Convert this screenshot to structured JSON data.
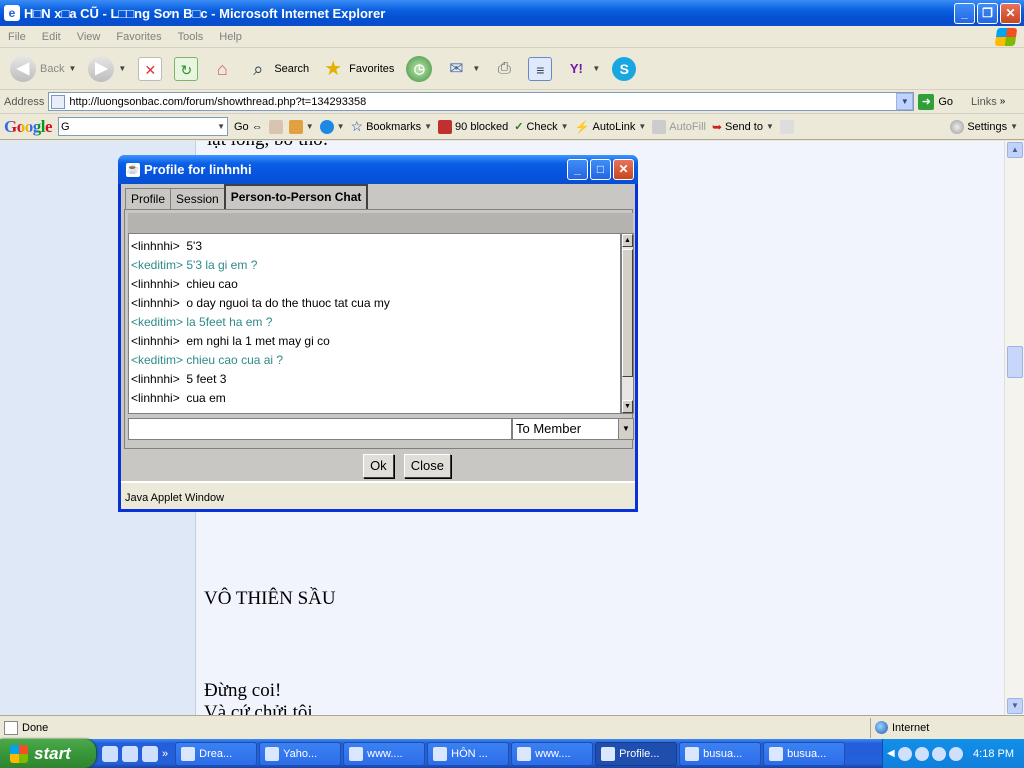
{
  "window": {
    "title": "H□N x□a CŨ - L□□ng Sơn B□c - Microsoft Internet Explorer",
    "menu": [
      "File",
      "Edit",
      "View",
      "Favorites",
      "Tools",
      "Help"
    ]
  },
  "toolbar": {
    "back_label": "Back",
    "search_label": "Search",
    "favorites_label": "Favorites"
  },
  "address": {
    "label": "Address",
    "url": "http://luongsonbac.com/forum/showthread.php?t=134293358",
    "go_label": "Go",
    "links_label": "Links"
  },
  "google_toolbar": {
    "logo": "Google",
    "search_value": "G",
    "go_label": "Go",
    "bookmarks_label": "Bookmarks",
    "blocked_label": "90 blocked",
    "check_label": "Check",
    "autolink_label": "AutoLink",
    "autofill_label": "AutoFill",
    "sendto_label": "Send to",
    "settings_label": "Settings"
  },
  "page": {
    "top_text": "lạt lòng, bơ thờ.",
    "heading": "VÔ THIÊN SẦU",
    "line1": "Đừng coi!",
    "line2": "Và cứ chửi tôi"
  },
  "applet": {
    "title": "Profile for linhnhi",
    "tabs": [
      "Profile",
      "Session",
      "Person-to-Person Chat"
    ],
    "active_tab": "Person-to-Person Chat",
    "messages": [
      {
        "user": "<linhnhi>",
        "text": "  5'3",
        "mine": false
      },
      {
        "user": "<keditim>",
        "text": " 5'3 la gi em ?",
        "mine": true
      },
      {
        "user": "<linhnhi>",
        "text": "  chieu cao",
        "mine": false
      },
      {
        "user": "<linhnhi>",
        "text": "  o day nguoi ta do the thuoc tat cua my",
        "mine": false
      },
      {
        "user": "<keditim>",
        "text": " la 5feet ha em ?",
        "mine": true
      },
      {
        "user": "<linhnhi>",
        "text": "  em nghi la 1 met may gi co",
        "mine": false
      },
      {
        "user": "<keditim>",
        "text": " chieu cao cua ai ?",
        "mine": true
      },
      {
        "user": "<linhnhi>",
        "text": "  5 feet 3",
        "mine": false
      },
      {
        "user": "<linhnhi>",
        "text": "  cua em",
        "mine": false
      }
    ],
    "message_input": "",
    "recipient": "To Member",
    "ok_label": "Ok",
    "close_label": "Close",
    "warning": "Java Applet Window"
  },
  "status": {
    "text": "Done",
    "zone": "Internet"
  },
  "taskbar": {
    "start_label": "start",
    "tasks": [
      "Drea...",
      "Yaho...",
      "www....",
      "HÔN ...",
      "www....",
      "Profile...",
      "busua...",
      "busua..."
    ],
    "active_task": "Profile...",
    "clock": "4:18 PM"
  },
  "colors": {
    "title_blue": "#0a5ee4",
    "chat_self": "#2e8a8a",
    "page_bg": "#eef2fb"
  }
}
